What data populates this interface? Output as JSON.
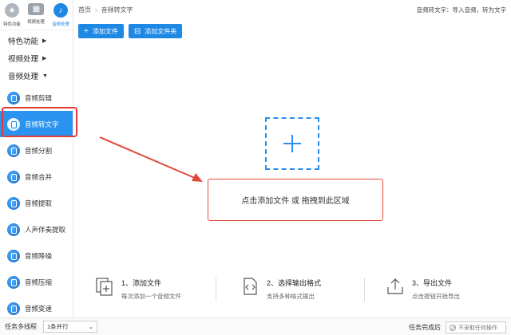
{
  "top_tabs": [
    {
      "label": "特色功能",
      "icon": "star-icon"
    },
    {
      "label": "视频处理",
      "icon": "film-icon"
    },
    {
      "label": "音频处理",
      "icon": "audio-icon"
    }
  ],
  "categories": [
    {
      "label": "特色功能",
      "arrow": "▶"
    },
    {
      "label": "视频处理",
      "arrow": "▶"
    },
    {
      "label": "音频处理",
      "arrow": "▼"
    }
  ],
  "tools": [
    {
      "label": "音频剪辑"
    },
    {
      "label": "音频转文字",
      "active": true
    },
    {
      "label": "音频分割"
    },
    {
      "label": "音频合并"
    },
    {
      "label": "音频提取"
    },
    {
      "label": "人声伴奏提取"
    },
    {
      "label": "音频降噪"
    },
    {
      "label": "音频压缩"
    },
    {
      "label": "音频变速"
    }
  ],
  "breadcrumb": {
    "home": "首页",
    "sep": "›",
    "current": "音频转文字"
  },
  "header_hint": "音频转文字：导入音频，转为文字",
  "toolbar": {
    "add_file": "添加文件",
    "add_folder": "添加文件夹",
    "add_file_glyph": "+",
    "add_folder_glyph": "⊟"
  },
  "dropzone": {
    "text": "点击添加文件 或 拖拽到此区域"
  },
  "steps": [
    {
      "title": "1、添加文件",
      "desc": "每次添加一个音频文件",
      "icon": "add-file-icon"
    },
    {
      "title": "2、选择输出格式",
      "desc": "支持多种格式输出",
      "icon": "format-icon"
    },
    {
      "title": "3、导出文件",
      "desc": "点击按钮开始导出",
      "icon": "export-icon"
    }
  ],
  "footer": {
    "threads_label": "任务多线程",
    "threads_value": "1条并行",
    "done_label": "任务完成后",
    "done_value": "不采取任何操作"
  },
  "colors": {
    "accent": "#1e88e5",
    "highlight": "#e53935"
  }
}
